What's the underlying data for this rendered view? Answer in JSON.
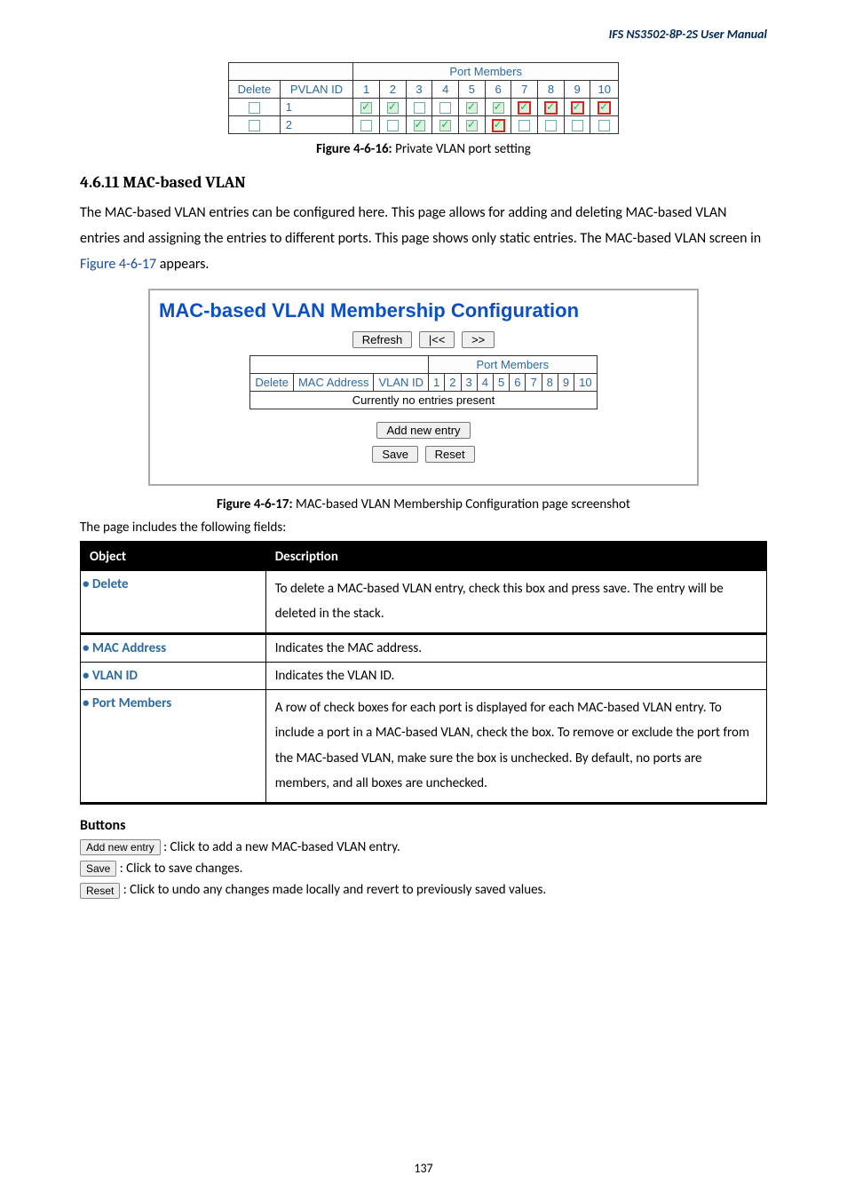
{
  "header": {
    "doctitle": "IFS  NS3502-8P-2S  User  Manual"
  },
  "pvlan_table": {
    "head": {
      "members": "Port Members",
      "del": "Delete",
      "id": "PVLAN ID",
      "cols": [
        "1",
        "2",
        "3",
        "4",
        "5",
        "6",
        "7",
        "8",
        "9",
        "10"
      ]
    },
    "rows": [
      {
        "id": "1",
        "state": [
          "g",
          "g",
          "u",
          "u",
          "g",
          "g",
          "gr",
          "gr",
          "gr",
          "gr"
        ]
      },
      {
        "id": "2",
        "state": [
          "u",
          "u",
          "g",
          "g",
          "g",
          "gr",
          "u",
          "u",
          "u",
          "u"
        ]
      }
    ]
  },
  "caption1": {
    "pre": "Figure 4-6-16: ",
    "txt": "Private VLAN port setting"
  },
  "section": {
    "num": "4.6.11 MAC-based VLAN"
  },
  "para1": {
    "t1": "The MAC-based VLAN entries can be configured here. This page allows for adding and deleting MAC-based VLAN entries and assigning the entries to different ports. This page shows only static entries. The MAC-based VLAN screen in ",
    "link": "Figure 4-6-17",
    "t2": " appears."
  },
  "panel": {
    "title": "MAC-based VLAN Membership Configuration",
    "btn_refresh": "Refresh",
    "btn_prev": "|<<",
    "btn_next": ">>",
    "members": "Port Members",
    "cols": {
      "del": "Delete",
      "mac": "MAC Address",
      "vlan": "VLAN ID"
    },
    "ports": [
      "1",
      "2",
      "3",
      "4",
      "5",
      "6",
      "7",
      "8",
      "9",
      "10"
    ],
    "empty": "Currently no entries present",
    "btn_add": "Add new entry",
    "btn_save": "Save",
    "btn_reset": "Reset"
  },
  "caption2": {
    "pre": "Figure 4-6-17: ",
    "txt": "MAC-based VLAN Membership Configuration page screenshot"
  },
  "intro2": "The page includes the following fields:",
  "objtable": {
    "h1": "Object",
    "h2": "Description",
    "r1": {
      "name": "Delete",
      "d": "To delete a MAC-based VLAN entry, check this box and press save. The entry will be deleted in the stack."
    },
    "r2": {
      "name": "MAC Address",
      "d": "Indicates the MAC address."
    },
    "r3": {
      "name": "VLAN ID",
      "d": "Indicates the VLAN ID."
    },
    "r4": {
      "name": "Port Members",
      "d": "A row of check boxes for each port is displayed for each MAC-based VLAN entry. To include a port in a MAC-based VLAN, check the box. To remove or exclude the port from the MAC-based VLAN, make sure the box is unchecked. By default, no ports are members, and all boxes are unchecked."
    }
  },
  "buttons": {
    "title": "Buttons",
    "add": "Add new entry",
    "add_t": ": Click to add a new MAC-based VLAN entry.",
    "save": "Save",
    "save_t": ": Click to save changes.",
    "reset": "Reset",
    "reset_t": ": Click to undo any changes made locally and revert to previously saved values."
  },
  "pagenum": "137"
}
